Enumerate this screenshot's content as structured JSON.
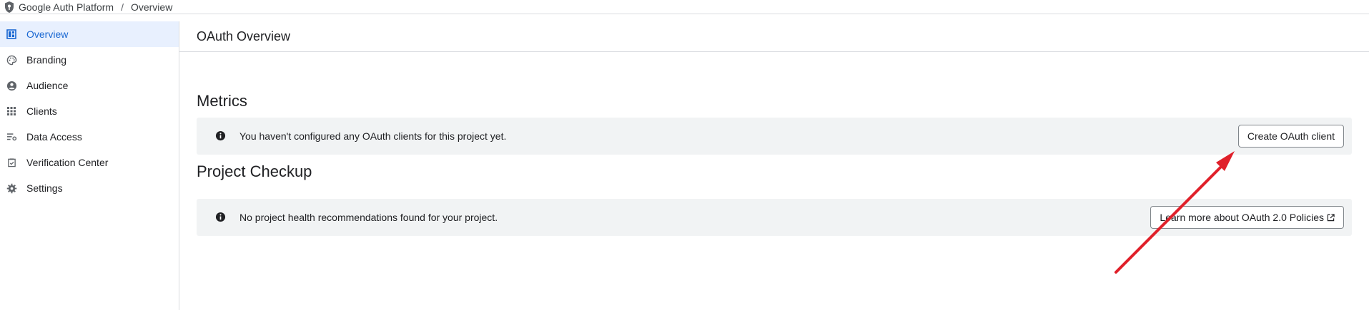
{
  "breadcrumb": {
    "app": "Google Auth Platform",
    "separator": "/",
    "page": "Overview"
  },
  "sidebar": {
    "items": [
      {
        "label": "Overview",
        "icon": "dashboard-icon",
        "active": true
      },
      {
        "label": "Branding",
        "icon": "palette-icon"
      },
      {
        "label": "Audience",
        "icon": "account-circle-icon"
      },
      {
        "label": "Clients",
        "icon": "apps-grid-icon"
      },
      {
        "label": "Data Access",
        "icon": "data-filter-icon"
      },
      {
        "label": "Verification Center",
        "icon": "verification-icon"
      },
      {
        "label": "Settings",
        "icon": "gear-icon"
      }
    ]
  },
  "main": {
    "title": "OAuth Overview",
    "metrics": {
      "heading": "Metrics",
      "message": "You haven't configured any OAuth clients for this project yet.",
      "button": "Create OAuth client"
    },
    "checkup": {
      "heading": "Project Checkup",
      "message": "No project health recommendations found for your project.",
      "button": "Learn more about OAuth 2.0 Policies"
    }
  },
  "colors": {
    "accent": "#1967d2",
    "active_bg": "#e8f0fe",
    "banner_bg": "#f1f3f4",
    "annotation_arrow": "#e0202a"
  }
}
